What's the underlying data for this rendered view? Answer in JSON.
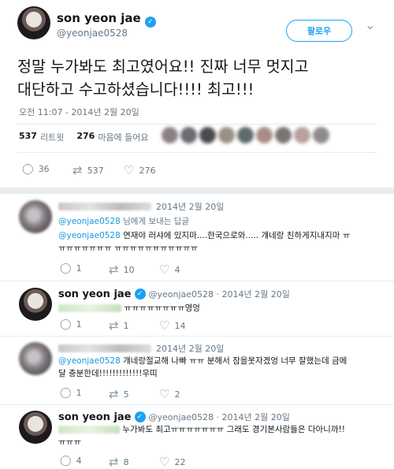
{
  "main_tweet": {
    "name": "son yeon jae",
    "handle": "@yeonjae0528",
    "follow_label": "팔로우",
    "text_line1": "정말 누가봐도 최고였어요!! 진짜 너무 멋지고",
    "text_line2": "대단하고 수고하셨습니다!!!! 최고!!!",
    "timestamp": "오전 11:07 - 2014년 2월 20일",
    "retweets_count": "537",
    "retweets_label": "리트윗",
    "likes_count": "276",
    "likes_label": "마음에 들어요",
    "actions": {
      "reply": "36",
      "retweet": "537",
      "like": "276"
    }
  },
  "replies": [
    {
      "date": "2014년 2월 20일",
      "reply_to_handle": "@yeonjae0528",
      "reply_to_label": " 님에게 보내는 답글",
      "mention": "@yeonjae0528",
      "text_line1": " 연재야 러샤에 있지마....한국으로와..... 걔네랑 친하게지내지마 ㅠ",
      "text_line2": "ㅠㅠㅠㅠㅠㅠㅠ ㅠㅠㅠㅠㅠㅠㅠㅠㅠㅠㅠ",
      "actions": {
        "reply": "1",
        "retweet": "10",
        "like": "4"
      }
    },
    {
      "name": "son yeon jae",
      "handle": "@yeonjae0528 · 2014년 2월 20일",
      "text_line1": " ㅠㅠㅠㅠㅠㅠㅠㅠ영엉",
      "actions": {
        "reply": "1",
        "retweet": "1",
        "like": "14"
      }
    },
    {
      "date": "2014년 2월 20일",
      "mention": "@yeonjae0528",
      "text_line1": " 걔네랑절교해 나빠 ㅠㅠ 분해서 잠을못자겠엉 너무 잘했는데 금메",
      "text_line2": "달 충분한데!!!!!!!!!!!!!우띠",
      "actions": {
        "reply": "1",
        "retweet": "5",
        "like": "2"
      }
    },
    {
      "name": "son yeon jae",
      "handle": "@yeonjae0528 · 2014년 2월 20일",
      "text_line1": " 누가봐도 최고ㅠㅠㅠㅠㅠㅠㅠ 그래도 경기본사람들은 다아니까!!",
      "text_line2": "ㅠㅠㅠ",
      "actions": {
        "reply": "4",
        "retweet": "8",
        "like": "22"
      }
    }
  ],
  "icons": {
    "verified": "✓",
    "chevron": "⌄",
    "reply": "◯",
    "retweet": "⇄",
    "like": "♡"
  }
}
